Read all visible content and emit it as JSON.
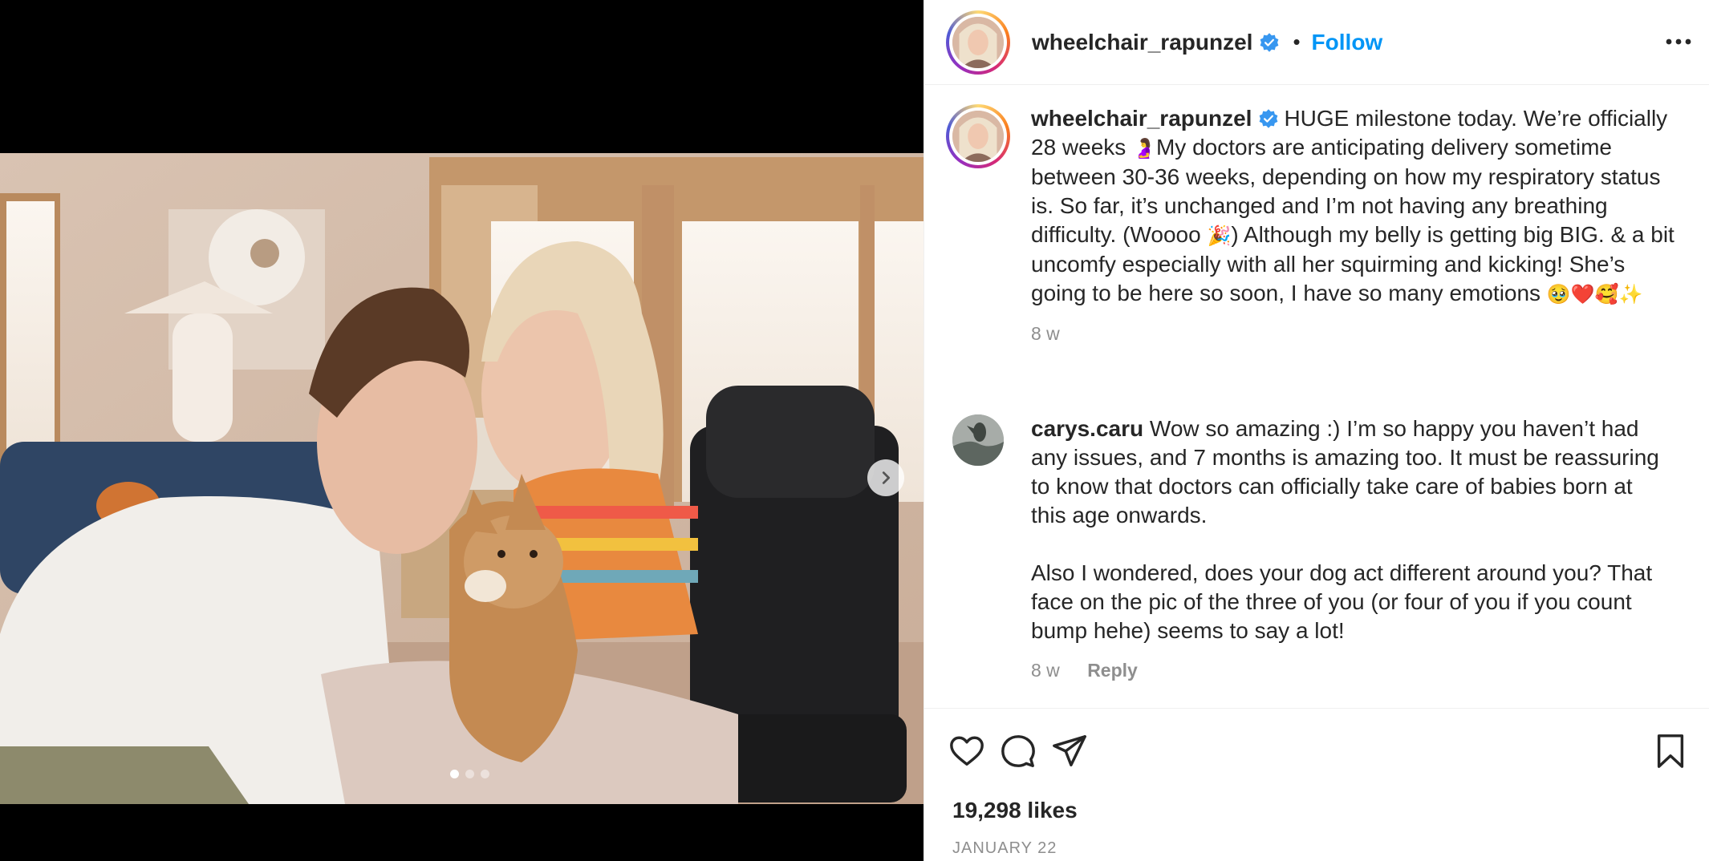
{
  "post": {
    "author": "wheelchair_rapunzel",
    "follow_label": "Follow",
    "separator": "•",
    "caption_prefix": "HUGE milestone today. We’re officially 28 weeks ",
    "caption_emoji_1": "🤰",
    "caption_middle": "My doctors are anticipating delivery sometime between 30-36 weeks, depending on how my respiratory status is. So far, it’s unchanged and I’m not having any breathing difficulty. (Woooo ",
    "caption_emoji_2": "🎉",
    "caption_suffix": ") Although my belly is getting big BIG. & a bit uncomfy especially with all her squirming and kicking! She’s going to be here so soon, I have so many emotions ",
    "caption_emoji_3": "🥹❤️🥰✨",
    "caption_time": "8 w"
  },
  "comment": {
    "author": "carys.caru",
    "text_1": "Wow so amazing :) I’m so happy you haven’t had any issues, and 7 months is amazing too. It must be reassuring to know that doctors can officially take care of babies born at this age onwards.",
    "text_2": "Also I wondered, does your dog act different around you? That face on the pic of the three of you (or four of you if you count bump hehe) seems to say a lot!",
    "time": "8 w",
    "reply_label": "Reply"
  },
  "footer": {
    "likes": "19,298 likes",
    "date": "JANUARY 22"
  },
  "carousel": {
    "slide_count": 3,
    "active_index": 0
  },
  "icons": {
    "verified": "verified-badge-icon",
    "more": "more-options-icon",
    "like": "heart-icon",
    "comment": "comment-bubble-icon",
    "share": "paper-plane-icon",
    "save": "bookmark-icon",
    "next": "chevron-right-icon"
  },
  "colors": {
    "accent": "#0095f6",
    "text": "#262626",
    "secondary": "#8e8e8e",
    "verified": "#3897f0"
  }
}
